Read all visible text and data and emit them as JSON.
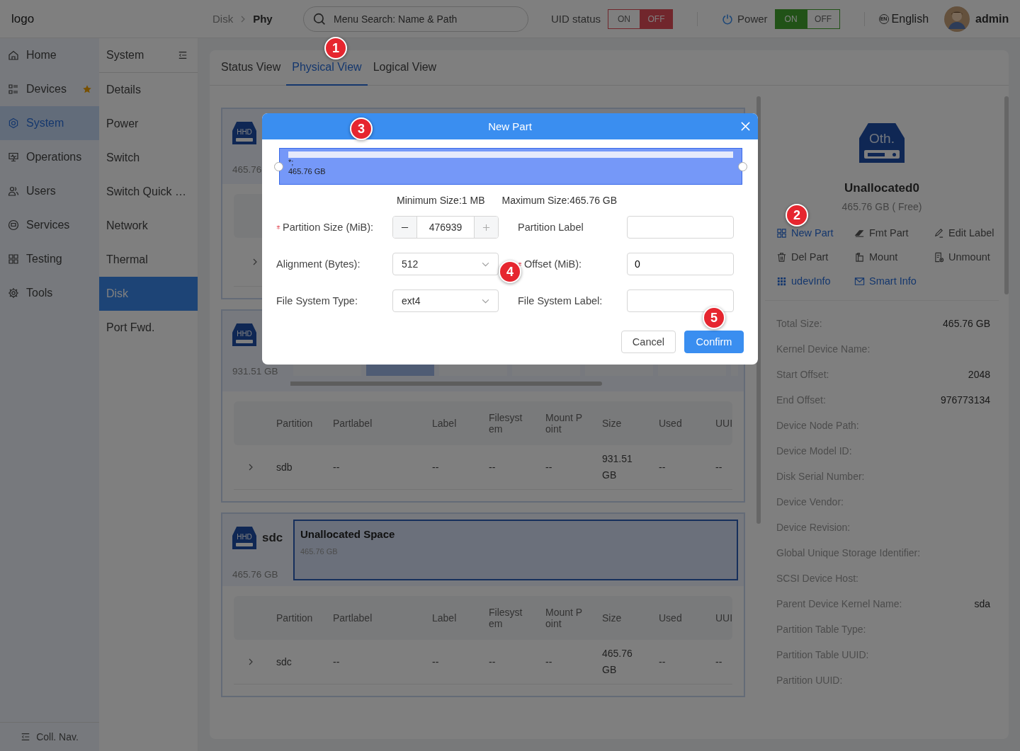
{
  "topbar": {
    "logo_alt": "logo",
    "breadcrumb": [
      "Disk",
      "Phy"
    ],
    "search": {
      "placeholder": "Menu Search: Name & Path"
    },
    "toggles": [
      {
        "kind": "plain",
        "label": "UID status",
        "options": [
          {
            "label": "ON",
            "selected": false
          },
          {
            "label": "OFF",
            "selected": true
          }
        ]
      },
      {
        "kind": "power",
        "label": "Power",
        "options": [
          {
            "label": "ON",
            "selected": true
          },
          {
            "label": "OFF",
            "selected": false
          }
        ]
      }
    ],
    "language": {
      "badge": "EN",
      "label": "English"
    },
    "user": "admin"
  },
  "nav": {
    "items": [
      {
        "label": "Home",
        "selected": false,
        "favorite": false
      },
      {
        "label": "Devices",
        "selected": false,
        "favorite": true
      },
      {
        "label": "System",
        "selected": true,
        "favorite": false
      },
      {
        "label": "Operations",
        "selected": false,
        "favorite": false
      },
      {
        "label": "Users",
        "selected": false,
        "favorite": false
      },
      {
        "label": "Services",
        "selected": false,
        "favorite": false
      },
      {
        "label": "Testing",
        "selected": false,
        "favorite": false
      },
      {
        "label": "Tools",
        "selected": false,
        "favorite": false
      }
    ],
    "collapse": "Coll. Nav."
  },
  "subnav": {
    "title": "System",
    "items": [
      {
        "label": "Details",
        "selected": false
      },
      {
        "label": "Power",
        "selected": false
      },
      {
        "label": "Switch",
        "selected": false
      },
      {
        "label": "Switch Quick …",
        "selected": false
      },
      {
        "label": "Network",
        "selected": false
      },
      {
        "label": "Thermal",
        "selected": false
      },
      {
        "label": "Disk",
        "selected": true
      },
      {
        "label": "Port Fwd.",
        "selected": false
      }
    ]
  },
  "tabs": [
    {
      "label": "Status View",
      "selected": false
    },
    {
      "label": "Physical View",
      "selected": true
    },
    {
      "label": "Logical View",
      "selected": false
    }
  ],
  "disks": [
    {
      "badge": "HHD",
      "size": "465.76",
      "table": {
        "rows": [
          {
            "expanded": false
          }
        ]
      }
    },
    {
      "badge": "HHD",
      "size": "931.51 GB",
      "blocks": [
        {
          "selected": false
        },
        {
          "selected": true
        },
        {
          "selected": false
        },
        {
          "selected": false
        },
        {
          "selected": false
        },
        {
          "selected": false
        },
        {
          "selected": false
        }
      ],
      "table": {
        "columns": [
          "Partition",
          "Partlabel",
          "Label",
          "Filesystem",
          "Mount Point",
          "Size",
          "Used",
          "UUI"
        ],
        "rows": [
          {
            "expanded": false,
            "cells": [
              "sdb",
              "--",
              "--",
              "--",
              "--",
              "931.51 GB",
              "--",
              "--"
            ]
          }
        ]
      }
    },
    {
      "badge": "HHD",
      "name": "sdc",
      "size": "465.76 GB",
      "space": {
        "title": "Unallocated Space",
        "size": "465.76 GB",
        "selected": true
      },
      "table": {
        "columns": [
          "Partition",
          "Partlabel",
          "Label",
          "Filesystem",
          "Mount Point",
          "Size",
          "Used",
          "UUI"
        ],
        "rows": [
          {
            "expanded": false,
            "cells": [
              "sdc",
              "--",
              "--",
              "--",
              "--",
              "465.76 GB",
              "--",
              "--"
            ]
          }
        ]
      }
    }
  ],
  "detail": {
    "badge": "Oth.",
    "name": "Unallocated0",
    "size": "465.76 GB ( Free)",
    "actions": [
      {
        "label": "New Part",
        "disabled": false
      },
      {
        "label": "Fmt Part",
        "disabled": true
      },
      {
        "label": "Edit Label",
        "disabled": true
      },
      {
        "label": "Del Part",
        "disabled": true
      },
      {
        "label": "Mount",
        "disabled": true
      },
      {
        "label": "Unmount",
        "disabled": true
      },
      {
        "label": "udevInfo",
        "disabled": false
      },
      {
        "label": "Smart Info",
        "disabled": false
      }
    ],
    "fields": [
      {
        "key": "Total Size:",
        "value": "465.76 GB"
      },
      {
        "key": "Kernel Device Name:"
      },
      {
        "key": "Start Offset:",
        "value": "2048"
      },
      {
        "key": "End Offset:",
        "value": "976773134"
      },
      {
        "key": "Device Node Path:"
      },
      {
        "key": "Device Model ID:"
      },
      {
        "key": "Disk Serial Number:"
      },
      {
        "key": "Device Vendor:"
      },
      {
        "key": "Device Revision:"
      },
      {
        "key": "Global Unique Storage Identifier:"
      },
      {
        "key": "SCSI Device Host:"
      },
      {
        "key": "Parent Device Kernel Name:",
        "value": "sda"
      },
      {
        "key": "Partition Table Type:"
      },
      {
        "key": "Partition Table UUID:"
      },
      {
        "key": "Partition UUID:"
      }
    ]
  },
  "dialog": {
    "title": "New Part",
    "range": {
      "mark": "*;",
      "size": "465.76 GB"
    },
    "min": "Minimum Size:1 MB",
    "max": "Maximum Size:465.76 GB",
    "form": [
      {
        "kind": "stepper",
        "label": "Partition Size (MiB):",
        "required": true,
        "value": "476939"
      },
      {
        "kind": "input",
        "label": "Partition Label",
        "required": false
      },
      {
        "kind": "select",
        "label": "Alignment (Bytes):",
        "required": false,
        "value": "512"
      },
      {
        "kind": "input",
        "label": "Offset (MiB):",
        "required": true,
        "value": "0"
      },
      {
        "kind": "select",
        "label": "File System Type:",
        "required": false,
        "value": "ext4"
      },
      {
        "kind": "input",
        "label": "File System Label:",
        "required": false
      }
    ],
    "buttons": [
      {
        "label": "Cancel",
        "kind": "secondary"
      },
      {
        "label": "Confirm",
        "kind": "primary"
      }
    ]
  },
  "callouts": [
    "1",
    "2",
    "3",
    "4",
    "5"
  ]
}
